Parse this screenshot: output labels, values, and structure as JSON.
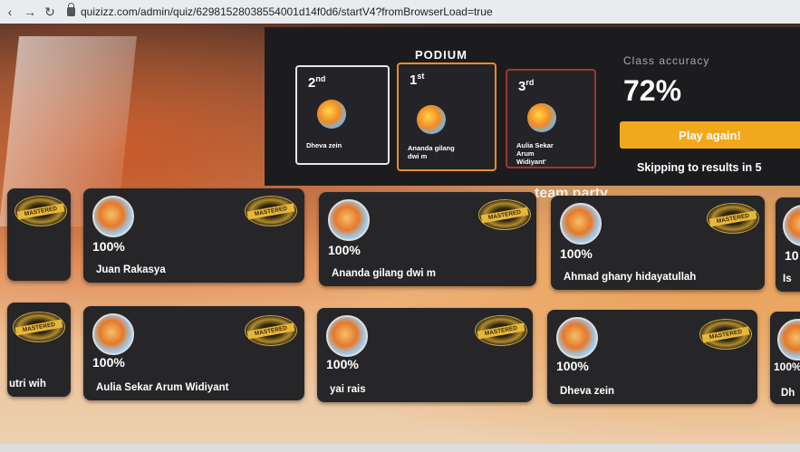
{
  "browser": {
    "url": "quizizz.com/admin/quiz/62981528038554001d14f0d6/startV4?fromBrowserLoad=true"
  },
  "podium": {
    "title": "PODIUM",
    "places": [
      {
        "rank": "2",
        "suffix": "nd",
        "name": "Dheva zein"
      },
      {
        "rank": "1",
        "suffix": "st",
        "name": "Ananda gilang dwi m"
      },
      {
        "rank": "3",
        "suffix": "rd",
        "name": "Aulia Sekar Arum Widiyant'"
      }
    ]
  },
  "accuracy": {
    "label": "Class accuracy",
    "value": "72%"
  },
  "actions": {
    "play_again": "Play again!",
    "skipping": "Skipping to results in 5"
  },
  "team_text": "team party",
  "badge_label": "MASTERED",
  "players_row1": [
    {
      "score": "",
      "name": ""
    },
    {
      "score": "100%",
      "name": "Juan Rakasya"
    },
    {
      "score": "100%",
      "name": "Ananda gilang dwi m"
    },
    {
      "score": "100%",
      "name": "Ahmad ghany hidayatullah"
    },
    {
      "score": "10",
      "name": "Is"
    }
  ],
  "players_row2": [
    {
      "score": "",
      "name": "utri wih"
    },
    {
      "score": "100%",
      "name": "Aulia Sekar Arum Widiyant"
    },
    {
      "score": "100%",
      "name": "yai rais"
    },
    {
      "score": "100%",
      "name": "Dheva zein"
    },
    {
      "score": "100%",
      "name": "Dh"
    }
  ]
}
